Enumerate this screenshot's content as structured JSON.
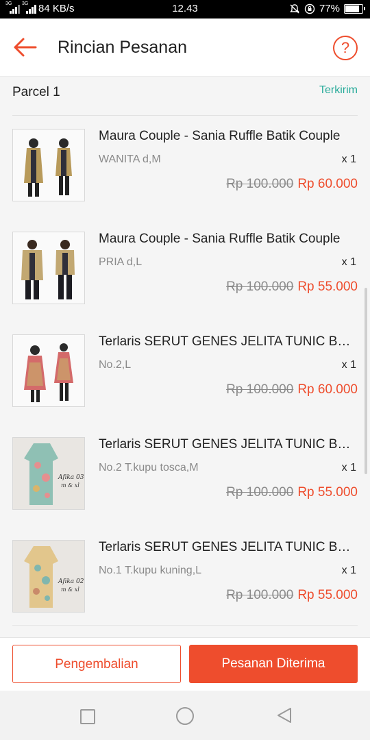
{
  "status_bar": {
    "signal1": "3G",
    "signal2": "3G",
    "speed": "84 KB/s",
    "time": "12.43",
    "battery": "77%",
    "battery_level": 0.77
  },
  "header": {
    "title": "Rincian Pesanan",
    "help": "?",
    "back_icon": "arrow-left-icon",
    "help_icon": "question-circle-icon",
    "accent": "#ee4d2d"
  },
  "parcel": {
    "label": "Parcel 1",
    "status": "Terkirim",
    "status_color": "#26aa99"
  },
  "items": [
    {
      "name": "Maura Couple - Sania Ruffle Batik Couple",
      "variant": "WANITA d,M",
      "qty": "x 1",
      "old_price": "Rp 100.000",
      "new_price": "Rp 60.000"
    },
    {
      "name": "Maura Couple - Sania Ruffle Batik Couple",
      "variant": "PRIA d,L",
      "qty": "x 1",
      "old_price": "Rp 100.000",
      "new_price": "Rp 55.000"
    },
    {
      "name": "Terlaris SERUT GENES JELITA TUNIC Batik",
      "variant": "No.2,L",
      "qty": "x 1",
      "old_price": "Rp 100.000",
      "new_price": "Rp 60.000"
    },
    {
      "name": "Terlaris SERUT GENES JELITA TUNIC Batik",
      "variant": "No.2 T.kupu tosca,M",
      "qty": "x 1",
      "old_price": "Rp 100.000",
      "new_price": "Rp 55.000"
    },
    {
      "name": "Terlaris SERUT GENES JELITA TUNIC Batik",
      "variant": "No.1 T.kupu kuning,L",
      "qty": "x 1",
      "old_price": "Rp 100.000",
      "new_price": "Rp 55.000"
    }
  ],
  "footer": {
    "return_label": "Pengembalian",
    "received_label": "Pesanan Diterima"
  }
}
